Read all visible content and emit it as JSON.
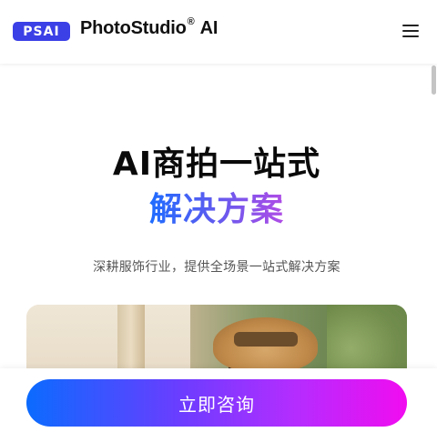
{
  "header": {
    "logo_text": "PSAI",
    "brand_name": "PhotoStudio",
    "brand_mark": "®",
    "brand_suffix": "AI",
    "menu_icon": "hamburger-menu-icon"
  },
  "hero": {
    "title": "AI商拍一站式",
    "subtitle": "解决方案",
    "description": "深耕服饰行业，提供全场景一站式解决方案"
  },
  "cta": {
    "label": "立即咨询"
  },
  "colors": {
    "brand_blue": "#3b3fe6",
    "gradient_start": "#0b6bff",
    "gradient_end": "#f10cf0"
  }
}
